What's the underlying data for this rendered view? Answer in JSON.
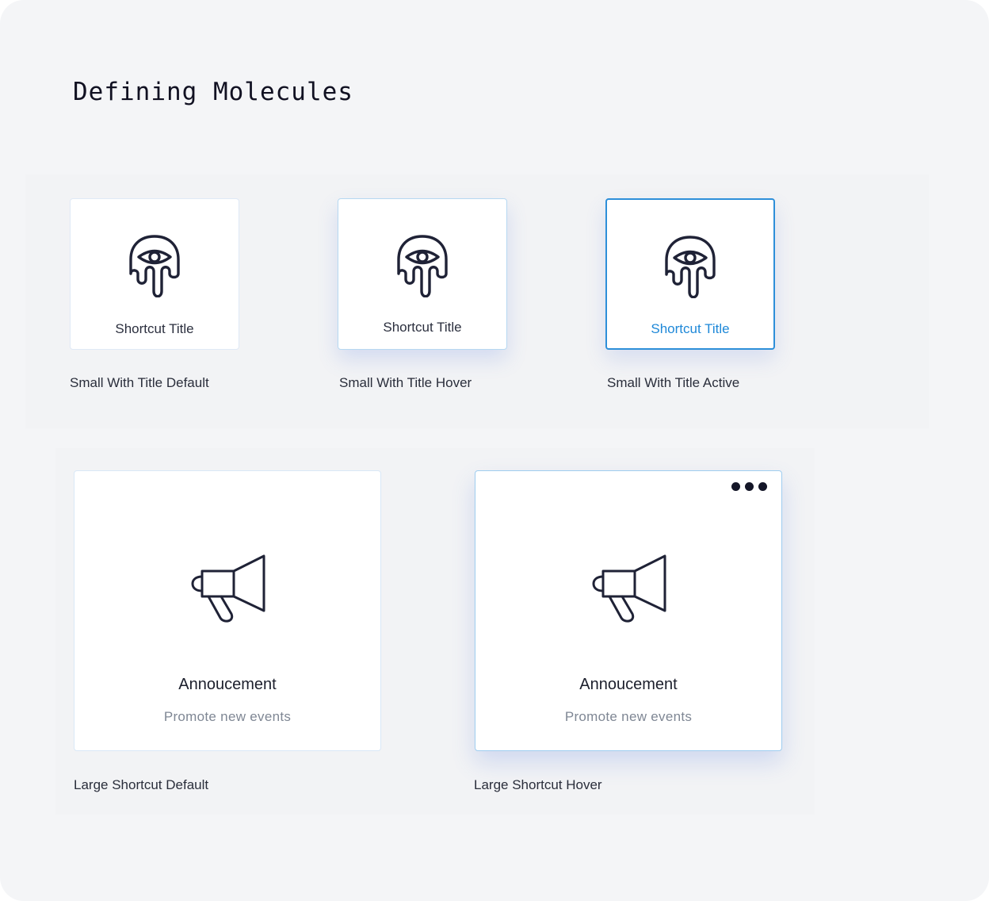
{
  "page": {
    "title": "Defining Molecules"
  },
  "small_cards": [
    {
      "title": "Shortcut Title",
      "caption": "Small With Title Default",
      "state": "default"
    },
    {
      "title": "Shortcut Title",
      "caption": "Small With Title Hover",
      "state": "hover"
    },
    {
      "title": "Shortcut Title",
      "caption": "Small With Title Active",
      "state": "active"
    }
  ],
  "large_cards": [
    {
      "title": "Annoucement",
      "subtitle": "Promote new events",
      "caption": "Large Shortcut Default",
      "state": "default"
    },
    {
      "title": "Annoucement",
      "subtitle": "Promote new events",
      "caption": "Large Shortcut Hover",
      "state": "hover",
      "menu_icon": "more-horizontal-icon"
    }
  ],
  "icons": {
    "small": "ghost-eye-icon",
    "large": "megaphone-icon"
  },
  "colors": {
    "background": "#f4f5f7",
    "icon_stroke": "#1f2236",
    "active_accent": "#1e88d8",
    "hover_border": "#b6d8f2",
    "subtitle": "#7f8794"
  }
}
